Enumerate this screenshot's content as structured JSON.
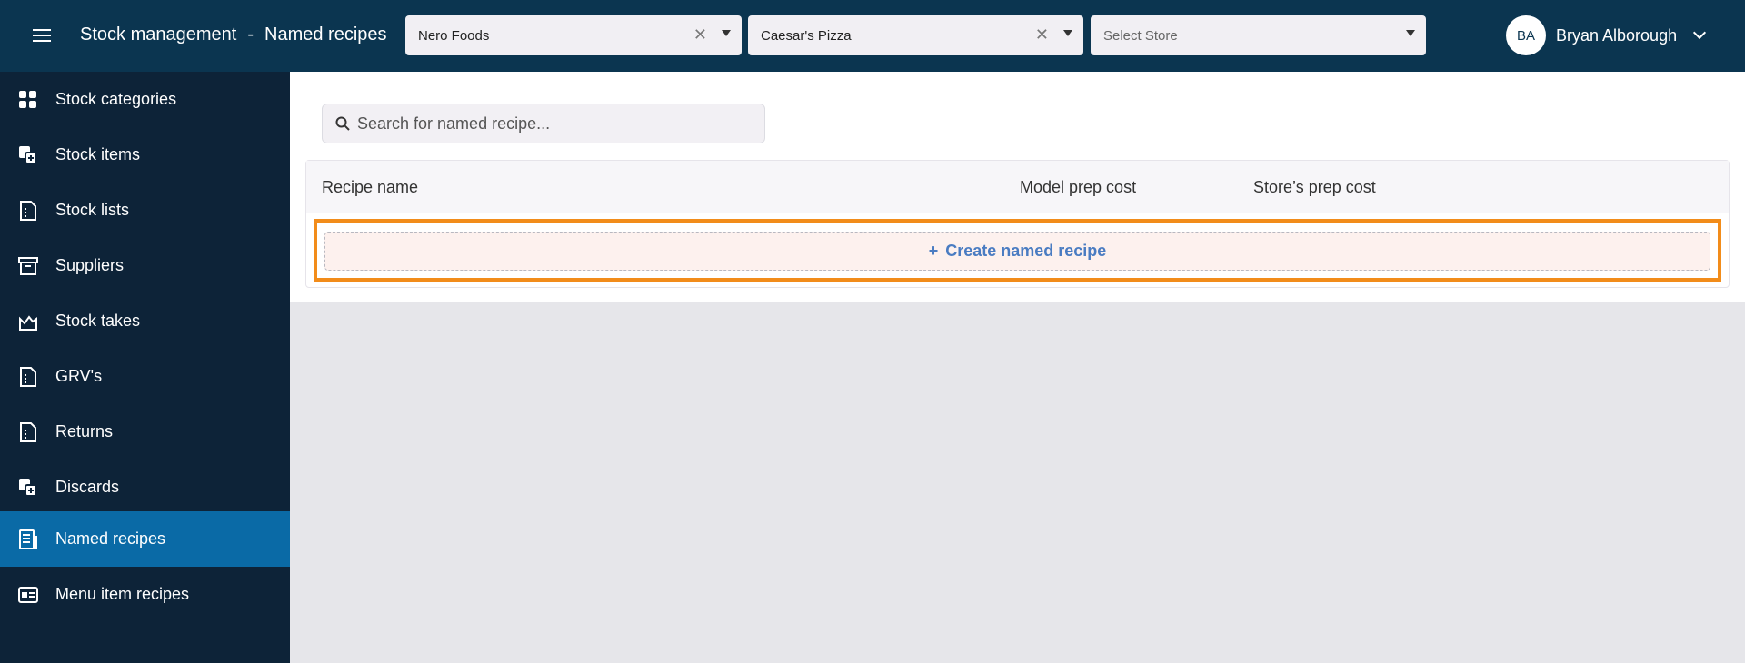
{
  "header": {
    "section": "Stock management",
    "separator": "-",
    "page": "Named recipes"
  },
  "filters": [
    {
      "value": "Nero Foods",
      "clearable": true
    },
    {
      "value": "Caesar's Pizza",
      "clearable": true
    },
    {
      "placeholder": "Select Store",
      "clearable": false
    }
  ],
  "user": {
    "initials": "BA",
    "name": "Bryan Alborough"
  },
  "sidebar": {
    "items": [
      {
        "label": "Stock categories",
        "icon": "grid-icon"
      },
      {
        "label": "Stock items",
        "icon": "stock-items-icon"
      },
      {
        "label": "Stock lists",
        "icon": "document-icon"
      },
      {
        "label": "Suppliers",
        "icon": "archive-box-icon"
      },
      {
        "label": "Stock takes",
        "icon": "chart-area-icon"
      },
      {
        "label": "GRV's",
        "icon": "document-icon"
      },
      {
        "label": "Returns",
        "icon": "document-icon"
      },
      {
        "label": "Discards",
        "icon": "stock-items-icon"
      },
      {
        "label": "Named recipes",
        "icon": "recipe-icon",
        "active": true
      },
      {
        "label": "Menu item recipes",
        "icon": "card-icon"
      }
    ]
  },
  "search": {
    "placeholder": "Search for named recipe..."
  },
  "table": {
    "columns": [
      "Recipe name",
      "Model prep cost",
      "Store’s prep cost"
    ],
    "rows": []
  },
  "create_button": {
    "label": "Create named recipe"
  },
  "colors": {
    "topbar": "#0b3550",
    "sidebar": "#0d2338",
    "active_item": "#0a6aa6",
    "highlight": "#f28c1a",
    "link": "#4a7cc2"
  }
}
